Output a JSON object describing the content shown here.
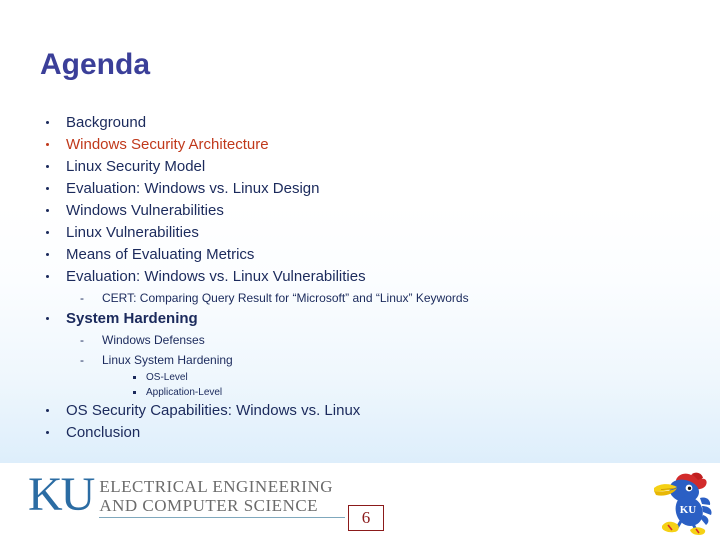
{
  "slide": {
    "title": "Agenda",
    "page_number": "6",
    "title_color": "#3b3f99",
    "body_color": "#1b2a5c",
    "accent_color": "#c0391b"
  },
  "bullets": [
    {
      "text": "Background",
      "level": 1,
      "style": "normal"
    },
    {
      "text": "Windows Security Architecture",
      "level": 1,
      "style": "accent"
    },
    {
      "text": "Linux Security Model",
      "level": 1,
      "style": "normal"
    },
    {
      "text": "Evaluation: Windows vs. Linux Design",
      "level": 1,
      "style": "normal"
    },
    {
      "text": "Windows Vulnerabilities",
      "level": 1,
      "style": "normal"
    },
    {
      "text": "Linux Vulnerabilities",
      "level": 1,
      "style": "normal"
    },
    {
      "text": "Means of Evaluating Metrics",
      "level": 1,
      "style": "normal"
    },
    {
      "text": "Evaluation: Windows vs. Linux Vulnerabilities",
      "level": 1,
      "style": "normal"
    },
    {
      "text": "CERT: Comparing Query Result for “Microsoft” and “Linux” Keywords",
      "level": 2,
      "style": "normal"
    },
    {
      "text": "System Hardening",
      "level": 1,
      "style": "bold"
    },
    {
      "text": "Windows Defenses",
      "level": 2,
      "style": "normal"
    },
    {
      "text": "Linux System Hardening",
      "level": 2,
      "style": "normal"
    },
    {
      "text": "OS-Level",
      "level": 3,
      "style": "normal"
    },
    {
      "text": "Application-Level",
      "level": 3,
      "style": "normal"
    },
    {
      "text": "OS Security Capabilities: Windows vs. Linux",
      "level": 1,
      "style": "normal"
    },
    {
      "text": "Conclusion",
      "level": 1,
      "style": "normal"
    }
  ],
  "footer": {
    "ku_mark": "KU",
    "department_line1": "ELECTRICAL ENGINEERING",
    "department_line2": "AND COMPUTER SCIENCE",
    "logo_color": "#2b6ca3",
    "mascot_name": "jayhawk-mascot",
    "mascot_label": "KU"
  }
}
